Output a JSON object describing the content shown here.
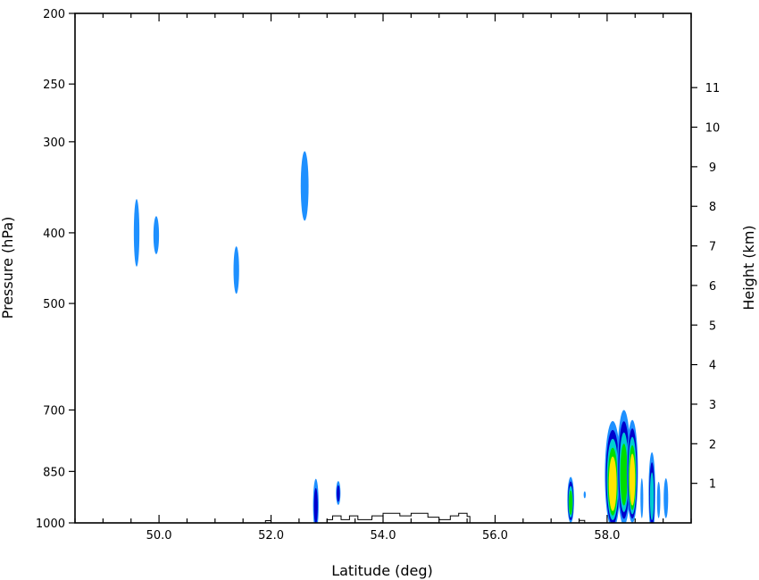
{
  "chart_data": {
    "type": "contour",
    "xlabel": "Latitude (deg)",
    "ylabel_left": "Pressure (hPa)",
    "ylabel_right": "Height (km)",
    "xlim": [
      48.5,
      59.5
    ],
    "x_ticks": [
      {
        "value": 50,
        "label": "50.0"
      },
      {
        "value": 52,
        "label": "52.0"
      },
      {
        "value": 54,
        "label": "54.0"
      },
      {
        "value": 56,
        "label": "56.0"
      },
      {
        "value": 58,
        "label": "58.0"
      }
    ],
    "pressure_range": [
      1000,
      200
    ],
    "pressure_scale": "log",
    "pressure_ticks": [
      {
        "value": 200,
        "label": "200"
      },
      {
        "value": 250,
        "label": "250"
      },
      {
        "value": 300,
        "label": "300"
      },
      {
        "value": 400,
        "label": "400"
      },
      {
        "value": 500,
        "label": "500"
      },
      {
        "value": 700,
        "label": "700"
      },
      {
        "value": 850,
        "label": "850"
      },
      {
        "value": 1000,
        "label": "1000"
      }
    ],
    "height_ticks": [
      {
        "value": 1,
        "label": "1"
      },
      {
        "value": 2,
        "label": "2"
      },
      {
        "value": 3,
        "label": "3"
      },
      {
        "value": 4,
        "label": "4"
      },
      {
        "value": 5,
        "label": "5"
      },
      {
        "value": 6,
        "label": "6"
      },
      {
        "value": 7,
        "label": "7"
      },
      {
        "value": 8,
        "label": "8"
      },
      {
        "value": 9,
        "label": "9"
      },
      {
        "value": 10,
        "label": "10"
      },
      {
        "value": 11,
        "label": "11"
      }
    ],
    "fill_levels": [
      {
        "color": "#1E90FF"
      },
      {
        "color": "#0000CD"
      },
      {
        "color": "#00CED1"
      },
      {
        "color": "#00DD00"
      },
      {
        "color": "#FFE600"
      }
    ],
    "features": [
      {
        "lat": 49.6,
        "p": 400,
        "lat_half": 0.05,
        "p_top": 365,
        "p_bot": 445,
        "levels": 1
      },
      {
        "lat": 49.95,
        "p": 403,
        "lat_half": 0.05,
        "p_top": 385,
        "p_bot": 428,
        "levels": 1
      },
      {
        "lat": 51.38,
        "p": 450,
        "lat_half": 0.05,
        "p_top": 425,
        "p_bot": 485,
        "levels": 1
      },
      {
        "lat": 52.6,
        "p": 345,
        "lat_half": 0.07,
        "p_top": 312,
        "p_bot": 385,
        "levels": 1
      },
      {
        "lat": 52.8,
        "p": 945,
        "lat_half": 0.05,
        "p_top": 870,
        "p_bot": 1000,
        "levels": 2
      },
      {
        "lat": 53.2,
        "p": 910,
        "lat_half": 0.04,
        "p_top": 885,
        "p_bot": 945,
        "levels": 2
      },
      {
        "lat": 57.35,
        "p": 930,
        "lat_half": 0.06,
        "p_top": 865,
        "p_bot": 1000,
        "levels": 4
      },
      {
        "lat": 57.6,
        "p": 915,
        "lat_half": 0.015,
        "p_top": 905,
        "p_bot": 925,
        "levels": 1
      },
      {
        "lat": 58.1,
        "p": 860,
        "lat_half": 0.14,
        "p_top": 725,
        "p_bot": 1000,
        "levels": 5
      },
      {
        "lat": 58.3,
        "p": 840,
        "lat_half": 0.12,
        "p_top": 700,
        "p_bot": 1000,
        "levels": 4
      },
      {
        "lat": 58.45,
        "p": 850,
        "lat_half": 0.1,
        "p_top": 725,
        "p_bot": 1000,
        "levels": 5
      },
      {
        "lat": 58.62,
        "p": 925,
        "lat_half": 0.025,
        "p_top": 880,
        "p_bot": 985,
        "levels": 1
      },
      {
        "lat": 58.8,
        "p": 910,
        "lat_half": 0.06,
        "p_top": 800,
        "p_bot": 1000,
        "levels": 3
      },
      {
        "lat": 58.92,
        "p": 930,
        "lat_half": 0.03,
        "p_top": 880,
        "p_bot": 985,
        "levels": 1
      },
      {
        "lat": 59.05,
        "p": 925,
        "lat_half": 0.04,
        "p_top": 885,
        "p_bot": 985,
        "levels": 1
      }
    ],
    "terrain": [
      [
        51.9,
        1000
      ],
      [
        51.9,
        993
      ],
      [
        52.0,
        993
      ],
      [
        52.0,
        1000
      ],
      [
        53.0,
        1000
      ],
      [
        53.0,
        990
      ],
      [
        53.1,
        990
      ],
      [
        53.1,
        978
      ],
      [
        53.25,
        978
      ],
      [
        53.25,
        990
      ],
      [
        53.4,
        990
      ],
      [
        53.4,
        978
      ],
      [
        53.55,
        978
      ],
      [
        53.55,
        990
      ],
      [
        53.8,
        990
      ],
      [
        53.8,
        978
      ],
      [
        54.0,
        978
      ],
      [
        54.0,
        970
      ],
      [
        54.3,
        970
      ],
      [
        54.3,
        978
      ],
      [
        54.5,
        978
      ],
      [
        54.5,
        970
      ],
      [
        54.8,
        970
      ],
      [
        54.8,
        982
      ],
      [
        55.0,
        982
      ],
      [
        55.0,
        990
      ],
      [
        55.2,
        990
      ],
      [
        55.2,
        978
      ],
      [
        55.35,
        978
      ],
      [
        55.35,
        970
      ],
      [
        55.5,
        970
      ],
      [
        55.5,
        980
      ],
      [
        55.55,
        980
      ],
      [
        55.55,
        1000
      ],
      [
        57.5,
        1000
      ],
      [
        57.5,
        992
      ],
      [
        57.6,
        992
      ],
      [
        57.6,
        1000
      ]
    ]
  }
}
